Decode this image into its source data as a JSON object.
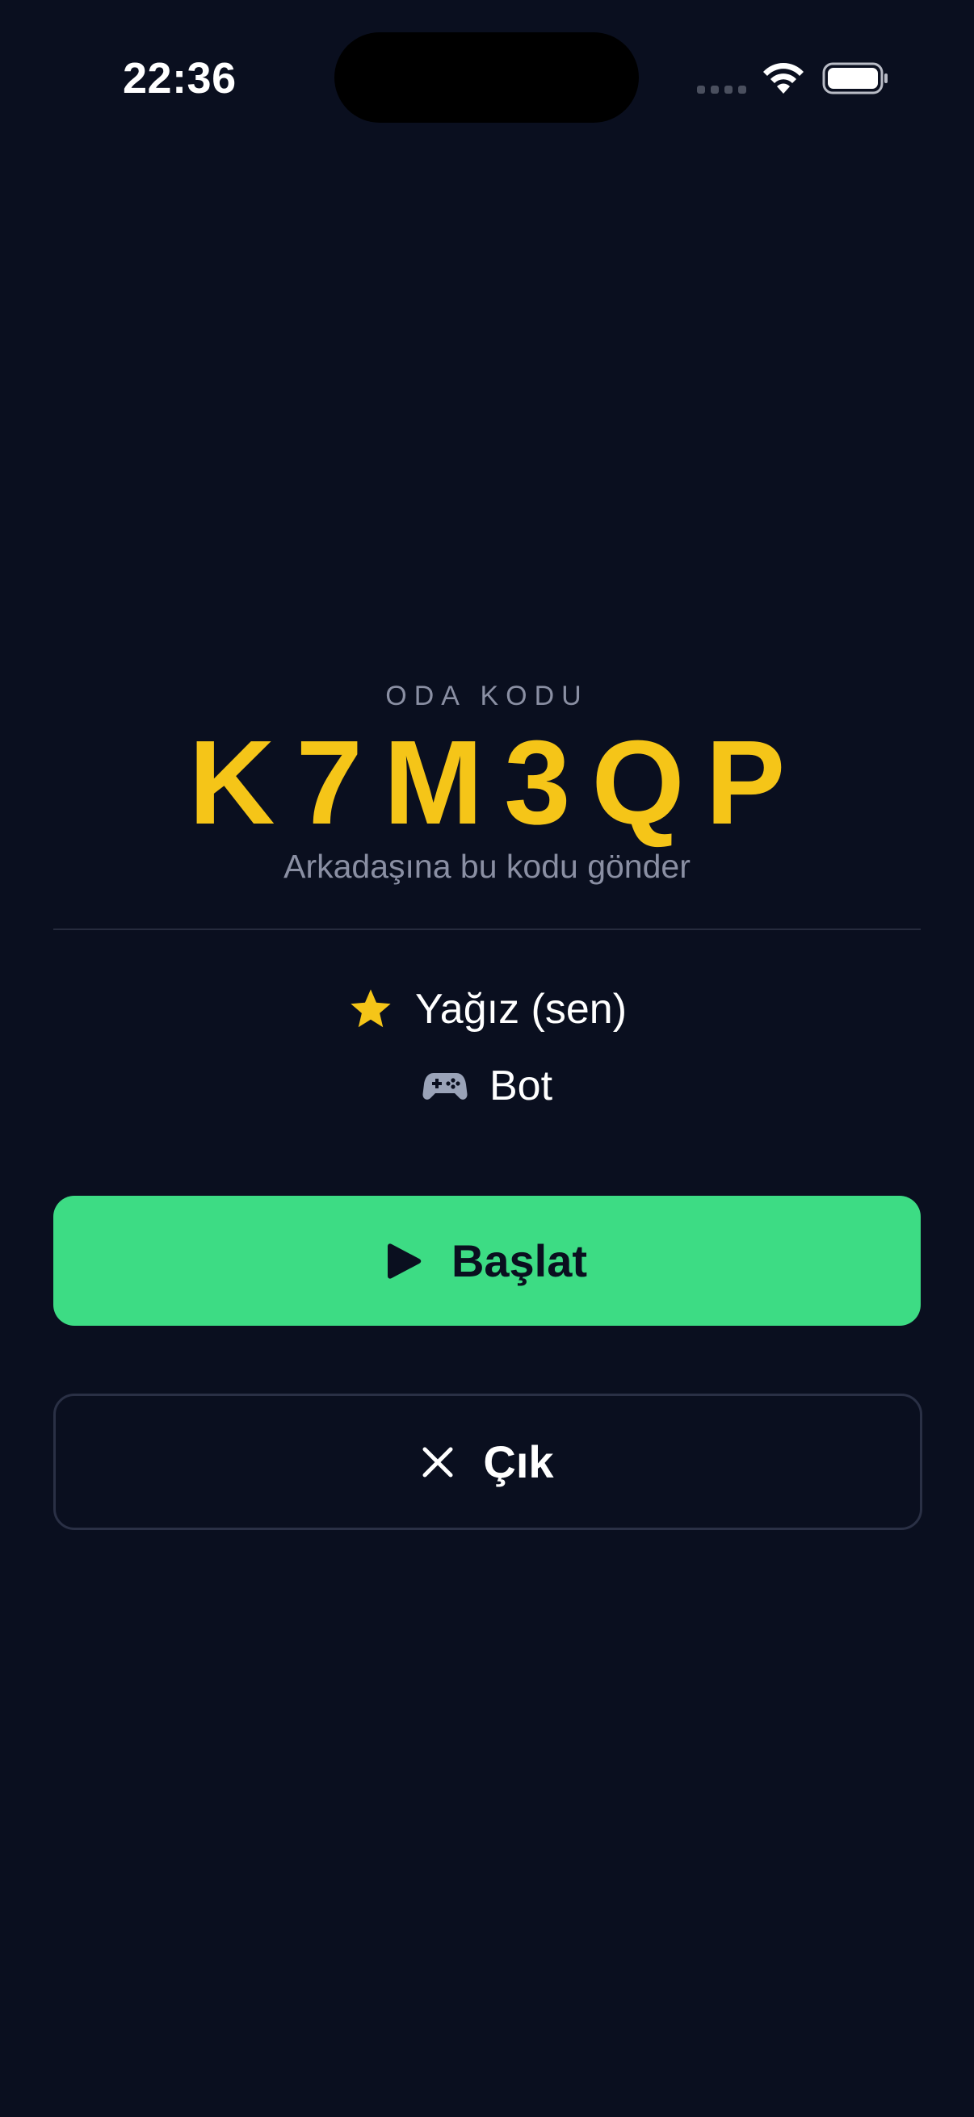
{
  "status_bar": {
    "time": "22:36",
    "icons": [
      "signal-icon",
      "wifi-icon",
      "battery-icon"
    ]
  },
  "room": {
    "label": "ODA KODU",
    "code": "K7M3QP",
    "hint": "Arkadaşına bu kodu gönder"
  },
  "players": [
    {
      "name": "Yağız (sen)",
      "icon": "star-icon"
    },
    {
      "name": "Bot",
      "icon": "gamepad-icon"
    }
  ],
  "actions": {
    "start_label": "Başlat",
    "start_icon": "play-icon",
    "exit_label": "Çık",
    "exit_icon": "close-icon"
  },
  "colors": {
    "background": "#0a0f1f",
    "accent_yellow": "#f5c518",
    "start_green": "#3ddc84",
    "muted_text": "#8a8fa3"
  }
}
